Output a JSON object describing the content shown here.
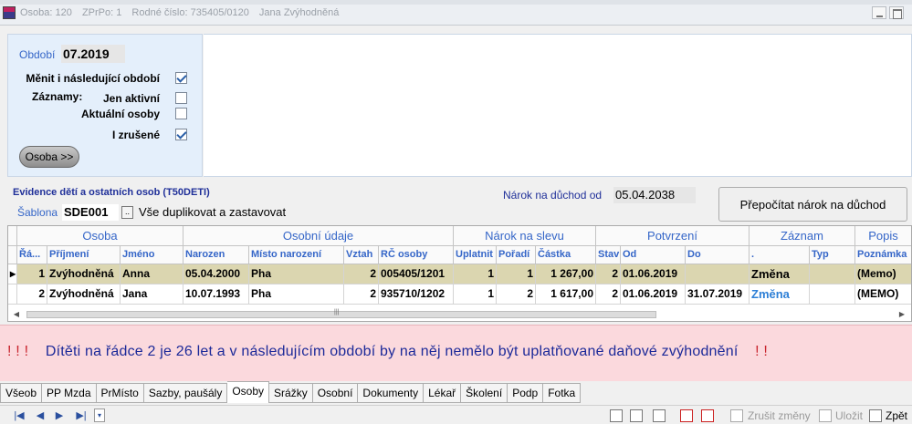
{
  "title": {
    "osoba": "Osoba: 120",
    "zprpo": "ZPrPo: 1",
    "rodne_cislo": "Rodné číslo: 735405/0120",
    "name": "Jana Zvýhodněná"
  },
  "filter": {
    "obdobi_label": "Období",
    "obdobi_value": "07.2019",
    "menit_label": "Měnit i následující období",
    "zaznamy_label": "Záznamy:",
    "jen_aktivni_label": "Jen aktivní",
    "aktualni_osoby_label": "Aktuální osoby",
    "i_zrusene_label": "I zrušené",
    "osoba_button": "Osoba >>"
  },
  "evidence": {
    "title": "Evidence dětí a ostatních osob   (T50DETI)",
    "narok_label": "Nárok na důchod od",
    "narok_value": "05.04.2038",
    "prepocitat_button": "Přepočítat nárok na důchod",
    "sablona_label": "Šablona",
    "sablona_value": "SDE001",
    "sablona_btn": "..",
    "sablona_desc": "Vše duplikovat a zastavovat"
  },
  "grid": {
    "groups": [
      "Osoba",
      "Osobní údaje",
      "Nárok na slevu",
      "Potvrzení",
      "Záznam",
      "Popis"
    ],
    "columns": [
      "Řá...",
      "Příjmení",
      "Jméno",
      "Narozen",
      "Místo narození",
      "Vztah",
      "RČ osoby",
      "Uplatnit",
      "Pořadí",
      "Částka",
      "Stav",
      "Od",
      "Do",
      ".",
      "Typ",
      "Poznámka"
    ],
    "rows": [
      {
        "indicator": "▸",
        "radek": "1",
        "prijmeni": "Zvýhodněná",
        "jmeno": "Anna",
        "narozen": "05.04.2000",
        "misto": "Pha",
        "vztah": "2",
        "rc": "005405/1201",
        "uplatnit": "1",
        "poradi": "1",
        "castka": "1 267,00",
        "stav": "2",
        "od": "01.06.2019",
        "do": "",
        "zaznam": "Změna",
        "typ": "",
        "poznamka": "(Memo)"
      },
      {
        "indicator": "",
        "radek": "2",
        "prijmeni": "Zvýhodněná",
        "jmeno": "Jana",
        "narozen": "10.07.1993",
        "misto": "Pha",
        "vztah": "2",
        "rc": "935710/1202",
        "uplatnit": "1",
        "poradi": "2",
        "castka": "1 617,00",
        "stav": "2",
        "od": "01.06.2019",
        "do": "31.07.2019",
        "zaznam": "Změna",
        "typ": "",
        "poznamka": "(MEMO)"
      }
    ],
    "scroll_left": "◀",
    "scroll_right": "▶",
    "scroll_grip": "|||"
  },
  "warning": {
    "prefix": "! ! !",
    "text": "Dítěti na řádce 2 je 26 let a v následujícím období by na něj nemělo být uplatňované daňové zvýhodnění",
    "suffix": "! !"
  },
  "tabs": [
    "Všeob",
    "PP Mzda",
    "PrMísto",
    "Sazby, paušály",
    "Osoby",
    "Srážky",
    "Osobní",
    "Dokumenty",
    "Lékař",
    "Školení",
    "Podp",
    "Fotka"
  ],
  "active_tab": "Osoby",
  "toolbar": {
    "nav_first": "|◀",
    "nav_prev": "◀",
    "nav_next": "▶",
    "nav_last": "▶|",
    "nav_select": "▾",
    "zrusit": "Zrušit změny",
    "ulozit": "Uložit",
    "zpet": "Zpět"
  }
}
